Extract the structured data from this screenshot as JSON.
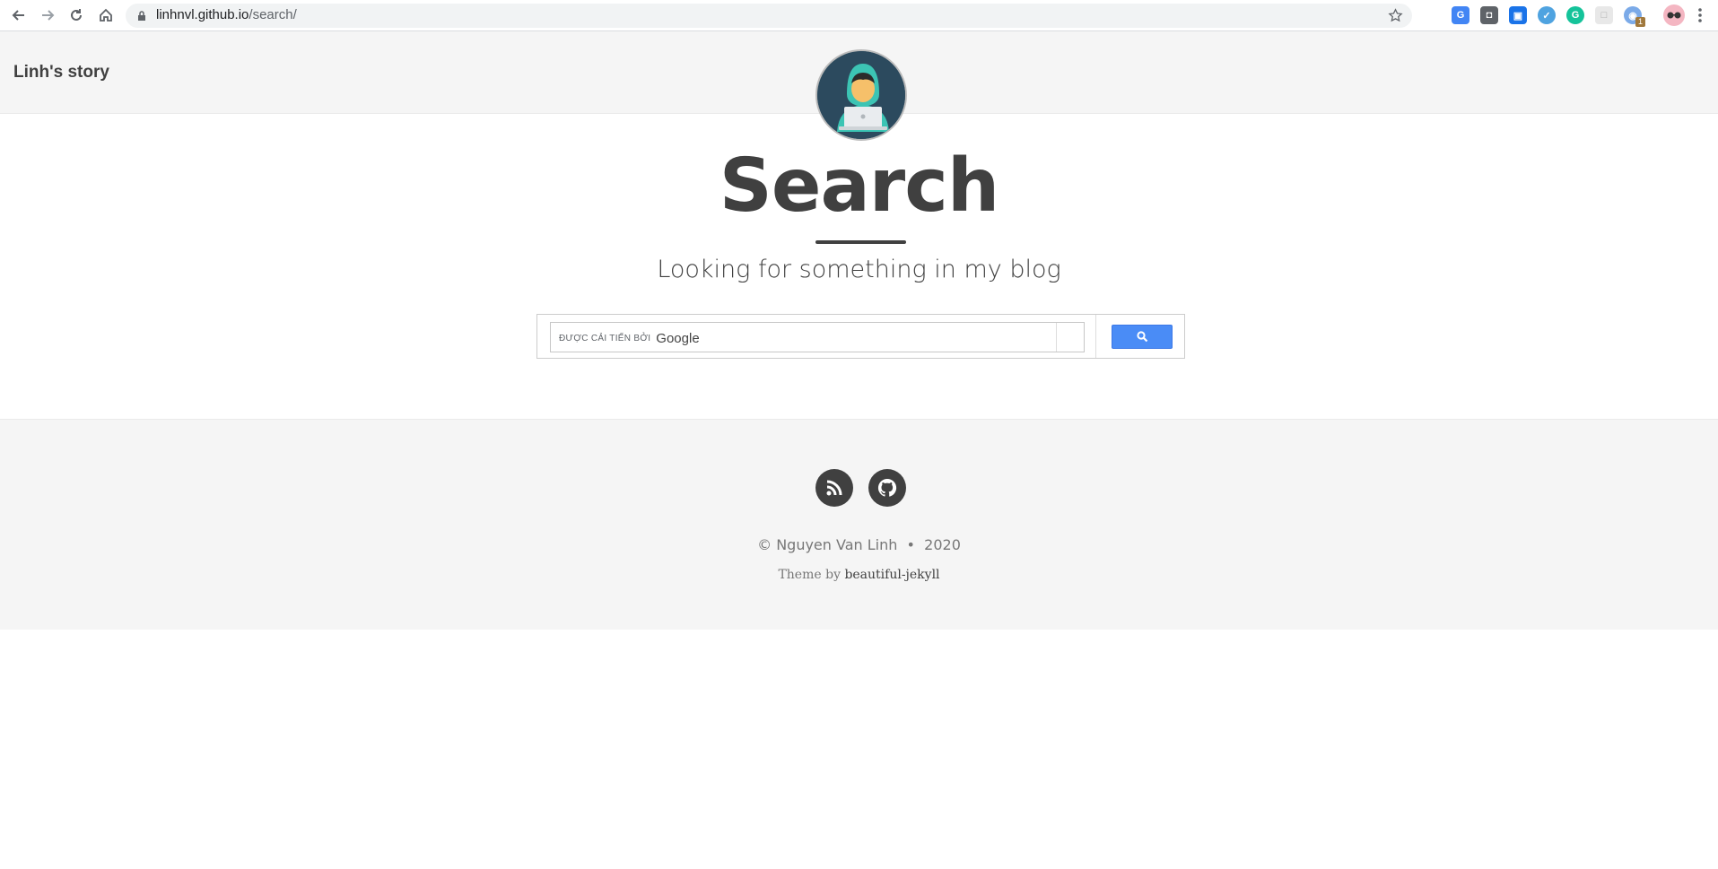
{
  "browser": {
    "url_host": "linhnvl.github.io",
    "url_path": "/search/",
    "extension_badge": "1"
  },
  "site": {
    "brand": "Linh's story"
  },
  "header": {
    "title": "Search",
    "subtitle": "Looking for something in my blog"
  },
  "search": {
    "enhanced_by": "ĐƯỢC CẢI TIẾN BỞI",
    "google": "Google"
  },
  "footer": {
    "copyright_name": "© Nguyen Van Linh",
    "separator": "•",
    "year": "2020",
    "theme_prefix": "Theme by",
    "theme_link": "beautiful-jekyll"
  },
  "colors": {
    "text": "#404040",
    "search_button": "#4a8cf6",
    "footer_bg": "#f5f5f5"
  }
}
